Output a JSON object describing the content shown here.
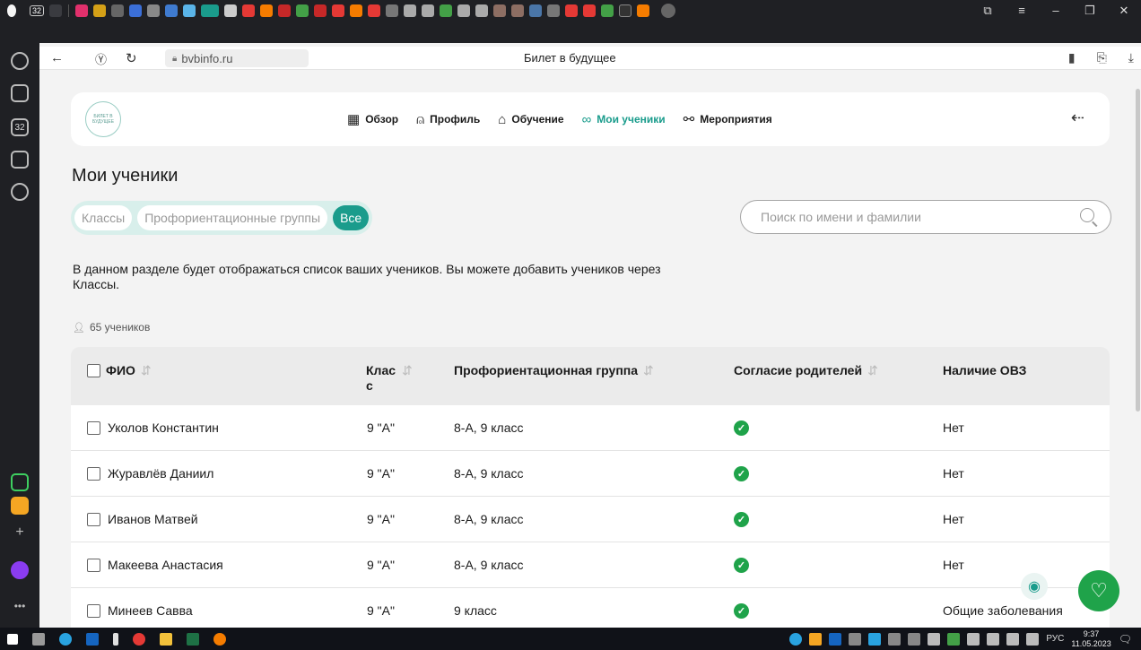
{
  "browser": {
    "tab_count_badge": "32",
    "url": "bvbinfo.ru",
    "page_title": "Билет в будущее"
  },
  "site": {
    "logo_text": "БИЛЕТ В БУДУЩЕЕ",
    "nav": [
      {
        "label": "Обзор",
        "icon": "grid-icon"
      },
      {
        "label": "Профиль",
        "icon": "user-icon"
      },
      {
        "label": "Обучение",
        "icon": "graduation-cap-icon"
      },
      {
        "label": "Мои ученики",
        "icon": "students-icon",
        "active": true
      },
      {
        "label": "Мероприятия",
        "icon": "handshake-icon"
      }
    ]
  },
  "page": {
    "heading": "Мои ученики",
    "filters": [
      {
        "label": "Классы",
        "active": false
      },
      {
        "label": "Профориентационные группы",
        "active": false
      },
      {
        "label": "Все",
        "active": true
      }
    ],
    "search_placeholder": "Поиск по имени и фамилии",
    "description": "В данном разделе будет отображаться список ваших учеников. Вы можете добавить учеников через Классы.",
    "count": "65 учеников"
  },
  "table": {
    "headers": {
      "name": "ФИО",
      "class": "Клас с",
      "group": "Профориентационная группа",
      "consent": "Согласие родителей",
      "ovz": "Наличие ОВЗ"
    },
    "rows": [
      {
        "name": "Уколов Константин",
        "class": "9 \"А\"",
        "group": "8-А, 9 класс",
        "consent": true,
        "ovz": "Нет"
      },
      {
        "name": "Журавлёв Даниил",
        "class": "9 \"А\"",
        "group": "8-А, 9 класс",
        "consent": true,
        "ovz": "Нет"
      },
      {
        "name": "Иванов Матвей",
        "class": "9 \"А\"",
        "group": "8-А, 9 класс",
        "consent": true,
        "ovz": "Нет"
      },
      {
        "name": "Макеева Анастасия",
        "class": "9 \"А\"",
        "group": "8-А, 9 класс",
        "consent": true,
        "ovz": "Нет"
      },
      {
        "name": "Минеев Савва",
        "class": "9 \"А\"",
        "group": "9 класс",
        "consent": true,
        "ovz": "Общие заболевания"
      }
    ]
  },
  "taskbar": {
    "lang": "РУС",
    "time": "9:37",
    "date": "11.05.2023"
  },
  "colors": {
    "accent": "#1a9c8c",
    "consent_ok": "#1fa34a",
    "filter_bg": "#d8efeb"
  }
}
